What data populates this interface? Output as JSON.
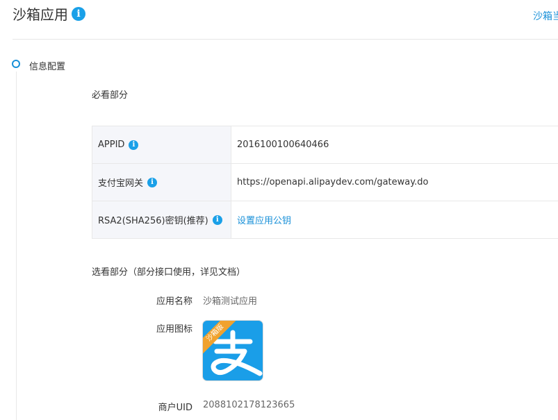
{
  "header": {
    "title": "沙箱应用",
    "info_icon": "info-icon",
    "right_link": "沙箱当"
  },
  "section": {
    "title": "信息配置"
  },
  "required": {
    "heading": "必看部分",
    "rows": [
      {
        "label": "APPID",
        "value": "2016100100640466",
        "is_link": false
      },
      {
        "label": "支付宝网关",
        "value": "https://openapi.alipaydev.com/gateway.do",
        "is_link": false
      },
      {
        "label": "RSA2(SHA256)密钥(推荐)",
        "value": "设置应用公钥",
        "is_link": true
      }
    ]
  },
  "optional": {
    "heading": "选看部分（部分接口使用，详见文档）",
    "app_name_label": "应用名称",
    "app_name_value": "沙箱测试应用",
    "app_icon_label": "应用图标",
    "app_icon_ribbon": "沙箱版",
    "merchant_uid_label": "商户UID",
    "merchant_uid_value": "2088102178123665"
  },
  "colors": {
    "accent": "#1890d8",
    "icon_bg": "#1a9ee8",
    "ribbon": "#f0a22e"
  }
}
